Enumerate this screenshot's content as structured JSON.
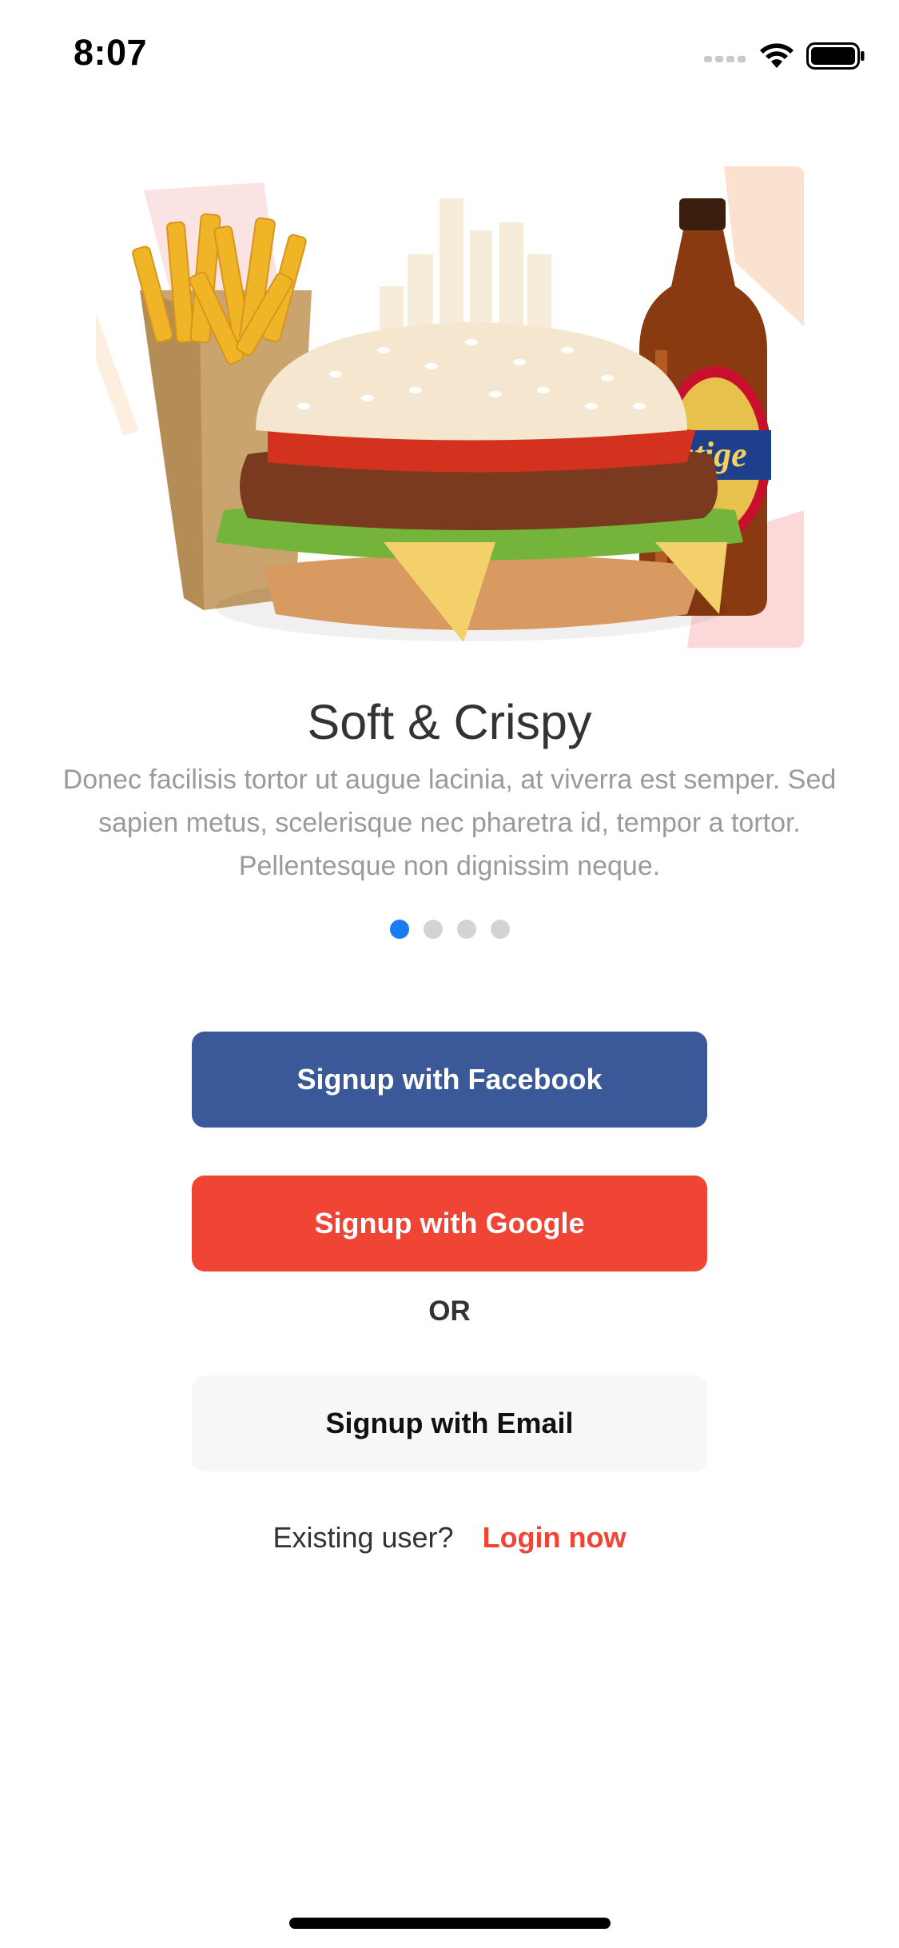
{
  "status_bar": {
    "time": "8:07"
  },
  "onboarding": {
    "title": "Soft & Crispy",
    "description": "Donec facilisis tortor ut augue lacinia, at viverra est semper. Sed sapien metus, scelerisque nec pharetra id, tempor a tortor. Pellentesque non dignissim neque.",
    "page_count": 4,
    "active_page": 1,
    "bottle_label": "estige"
  },
  "buttons": {
    "facebook": "Signup with Facebook",
    "google": "Signup with Google",
    "or": "OR",
    "email": "Signup with Email"
  },
  "footer": {
    "existing_user": "Existing user?",
    "login": "Login now"
  },
  "colors": {
    "facebook": "#3b5998",
    "google": "#f04435",
    "email_bg": "#f7f7f7",
    "accent": "#f04435",
    "dot_active": "#1a7cf2"
  }
}
